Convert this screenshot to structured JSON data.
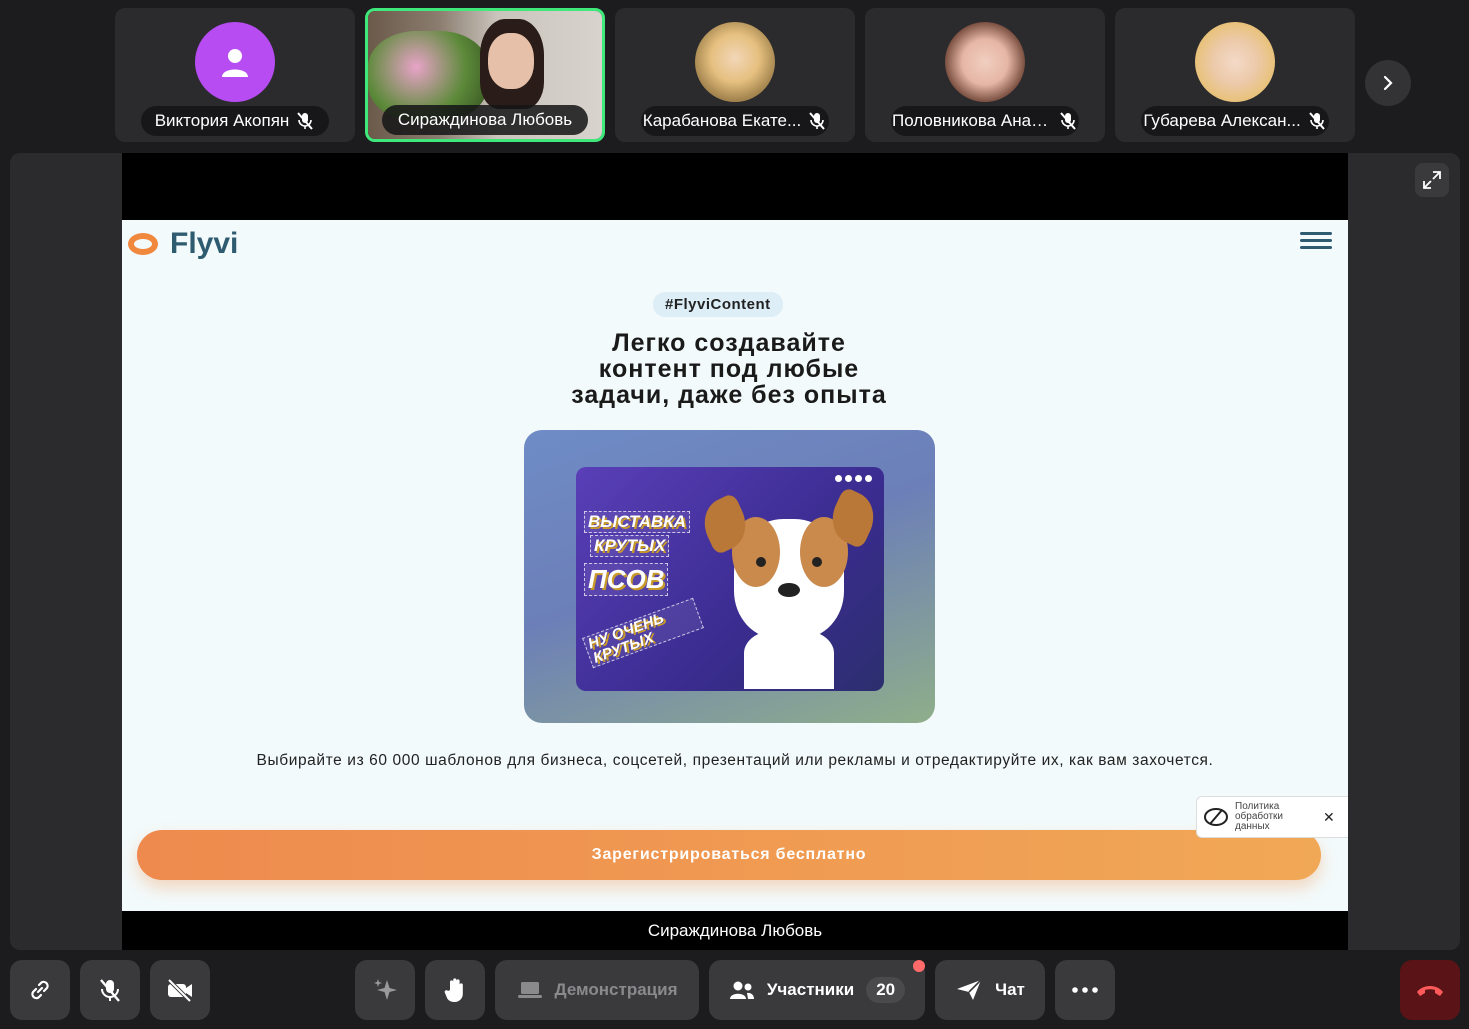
{
  "participants": [
    {
      "name": "Виктория Акопян",
      "avatar": "person-placeholder",
      "muted": true
    },
    {
      "name": "Сираждинова Любовь",
      "avatar": "video",
      "muted": false,
      "active_speaker": true
    },
    {
      "name": "Карабанова Екате...",
      "avatar": "photo",
      "muted": true
    },
    {
      "name": "Половникова Анас...",
      "avatar": "photo",
      "muted": true
    },
    {
      "name": "Губарева Алексан...",
      "avatar": "photo",
      "muted": true
    }
  ],
  "shared_screen": {
    "presenter_caption": "Сираждинова Любовь",
    "site": {
      "logo_text": "Flyvi",
      "tag": "#FlyviContent",
      "headline_lines": [
        "Легко создавайте",
        "контент под любые",
        "задачи, даже без опыта"
      ],
      "poster_lines": [
        "ВЫСТАВКА",
        "КРУТЫХ",
        "ПСОВ",
        "НУ ОЧЕНЬ КРУТЫХ"
      ],
      "description": "Выбирайте из 60 000 шаблонов для бизнеса, соцсетей, презентаций или рекламы и отредактируйте их, как вам захочется.",
      "cta_label": "Зарегистрироваться бесплатно",
      "policy_text": "Политика обработки данных",
      "policy_close": "✕"
    }
  },
  "toolbar": {
    "screen_share_label": "Демонстрация",
    "participants_label": "Участники",
    "participants_count": "20",
    "chat_label": "Чат"
  },
  "colors": {
    "active_speaker_border": "#3ee87b",
    "cta_start": "#ee8a4e",
    "cta_end": "#f1a856",
    "hangup": "#5a1418",
    "avatar_purple": "#b64cf2"
  }
}
